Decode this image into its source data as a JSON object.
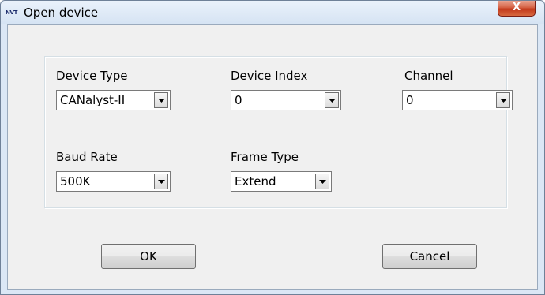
{
  "window": {
    "title": "Open device",
    "icon_text": "NVT",
    "close_label": "X"
  },
  "form": {
    "device_type": {
      "label": "Device Type",
      "value": "CANalyst-II"
    },
    "device_index": {
      "label": "Device Index",
      "value": "0"
    },
    "channel": {
      "label": "Channel",
      "value": "0"
    },
    "baud_rate": {
      "label": "Baud Rate",
      "value": "500K"
    },
    "frame_type": {
      "label": "Frame Type",
      "value": "Extend"
    }
  },
  "buttons": {
    "ok": "OK",
    "cancel": "Cancel"
  },
  "icons": {
    "app": "app-logo-icon",
    "close": "close-icon",
    "dropdown": "chevron-down-icon"
  },
  "colors": {
    "close_button": "#c2391c",
    "title_bar": "#dbe7f5",
    "client_background": "#f0f0f0"
  }
}
